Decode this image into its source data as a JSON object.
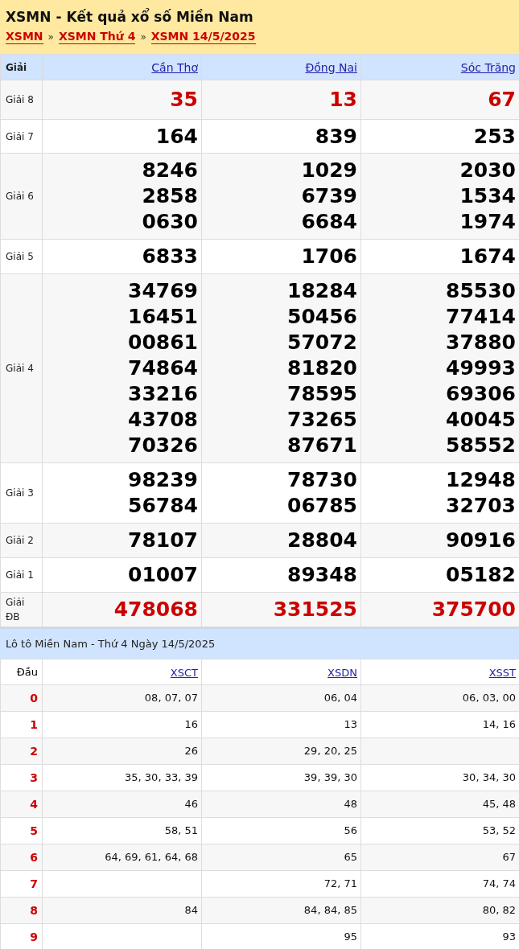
{
  "header": {
    "title": "XSMN - Kết quả xổ số Miền Nam",
    "breadcrumbs": [
      "XSMN",
      "XSMN Thứ 4",
      "XSMN 14/5/2025"
    ],
    "separator": "»"
  },
  "results": {
    "corner": "Giải",
    "provinces": [
      "Cần Thơ",
      "Đồng Nai",
      "Sóc Trăng"
    ],
    "rows": [
      {
        "prize": "Giải 8",
        "kind": "accent",
        "numbers": [
          [
            "35"
          ],
          [
            "13"
          ],
          [
            "67"
          ]
        ]
      },
      {
        "prize": "Giải 7",
        "kind": "normal",
        "numbers": [
          [
            "164"
          ],
          [
            "839"
          ],
          [
            "253"
          ]
        ]
      },
      {
        "prize": "Giải 6",
        "kind": "normal",
        "numbers": [
          [
            "8246",
            "2858",
            "0630"
          ],
          [
            "1029",
            "6739",
            "6684"
          ],
          [
            "2030",
            "1534",
            "1974"
          ]
        ]
      },
      {
        "prize": "Giải 5",
        "kind": "normal",
        "numbers": [
          [
            "6833"
          ],
          [
            "1706"
          ],
          [
            "1674"
          ]
        ]
      },
      {
        "prize": "Giải 4",
        "kind": "normal",
        "numbers": [
          [
            "34769",
            "16451",
            "00861",
            "74864",
            "33216",
            "43708",
            "70326"
          ],
          [
            "18284",
            "50456",
            "57072",
            "81820",
            "78595",
            "73265",
            "87671"
          ],
          [
            "85530",
            "77414",
            "37880",
            "49993",
            "69306",
            "40045",
            "58552"
          ]
        ]
      },
      {
        "prize": "Giải 3",
        "kind": "normal",
        "numbers": [
          [
            "98239",
            "56784"
          ],
          [
            "78730",
            "06785"
          ],
          [
            "12948",
            "32703"
          ]
        ]
      },
      {
        "prize": "Giải 2",
        "kind": "normal",
        "numbers": [
          [
            "78107"
          ],
          [
            "28804"
          ],
          [
            "90916"
          ]
        ]
      },
      {
        "prize": "Giải 1",
        "kind": "normal",
        "numbers": [
          [
            "01007"
          ],
          [
            "89348"
          ],
          [
            "05182"
          ]
        ]
      },
      {
        "prize": "Giải ĐB",
        "kind": "accent",
        "numbers": [
          [
            "478068"
          ],
          [
            "331525"
          ],
          [
            "375700"
          ]
        ]
      }
    ]
  },
  "loto": {
    "title": "Lô tô Miền Nam - Thứ 4 Ngày 14/5/2025",
    "corner": "Đầu",
    "columns": [
      "XSCT",
      "XSDN",
      "XSST"
    ],
    "rows": [
      {
        "head": "0",
        "cells": [
          "08, 07, 07",
          "06, 04",
          "06, 03, 00"
        ]
      },
      {
        "head": "1",
        "cells": [
          "16",
          "13",
          "14, 16"
        ]
      },
      {
        "head": "2",
        "cells": [
          "26",
          "29, 20, 25",
          null
        ]
      },
      {
        "head": "3",
        "cells": [
          "35, 30, 33, 39",
          "39, 39, 30",
          "30, 34, 30"
        ]
      },
      {
        "head": "4",
        "cells": [
          "46",
          "48",
          "45, 48"
        ]
      },
      {
        "head": "5",
        "cells": [
          "58, 51",
          "56",
          "53, 52"
        ]
      },
      {
        "head": "6",
        "cells": [
          "64, 69, 61, 64, 68",
          "65",
          "67"
        ]
      },
      {
        "head": "7",
        "cells": [
          null,
          "72, 71",
          "74, 74"
        ]
      },
      {
        "head": "8",
        "cells": [
          "84",
          "84, 84, 85",
          "80, 82"
        ]
      },
      {
        "head": "9",
        "cells": [
          null,
          "95",
          "93"
        ]
      }
    ]
  }
}
